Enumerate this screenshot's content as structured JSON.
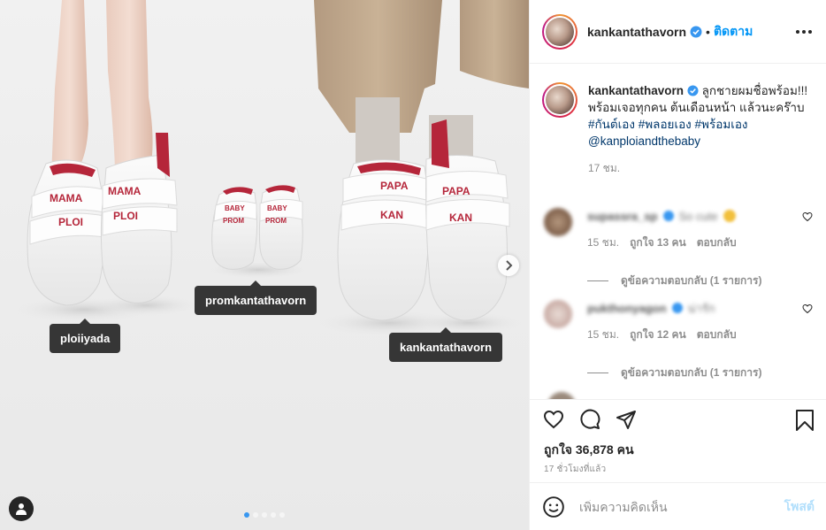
{
  "photo": {
    "tags": [
      "ploiiyada",
      "promkantathavorn",
      "kankantathavorn"
    ],
    "shoe_labels": {
      "mama_word": "MAMA",
      "ploi_word": "PLOI",
      "baby_word": "BABY",
      "prom_word": "PROM",
      "papa_word": "PAPA",
      "kan_word": "KAN"
    },
    "carousel_dots": 5,
    "active_dot": 0
  },
  "header": {
    "username": "kankantathavorn",
    "separator": "•",
    "follow_label": "ติดตาม"
  },
  "caption": {
    "username": "kankantathavorn",
    "text_plain": "ลูกชายผมชื่อพร้อม!!! พร้อมเจอทุกคน ต้นเดือนหน้า แล้วนะคร๊าบ",
    "hashtag1": "#กันต์เอง",
    "hashtag2": "#พลอยเอง",
    "hashtag3": "#พร้อมเอง",
    "mention": "@kanploiandthebaby",
    "time": "17 ชม."
  },
  "comments": [
    {
      "username": "supassra_sp",
      "text": "So cute",
      "time": "15 ชม.",
      "likes": "ถูกใจ 13 คน",
      "reply_label": "ตอบกลับ",
      "view_replies": "ดูข้อความตอบกลับ (1 รายการ)"
    },
    {
      "username": "pukthonyagon",
      "text": "น่ารัก",
      "time": "15 ชม.",
      "likes": "ถูกใจ 12 คน",
      "reply_label": "ตอบกลับ",
      "view_replies": "ดูข้อความตอบกลับ (1 รายการ)"
    }
  ],
  "actions": {
    "likes_text": "ถูกใจ 36,878 คน",
    "time_ago": "17 ชั่วโมงที่แล้ว"
  },
  "add_comment": {
    "placeholder": "เพิ่มความคิดเห็น",
    "post_label": "โพสต์"
  },
  "colors": {
    "link_blue": "#0095f6",
    "verified_blue": "#3897f0",
    "muted": "#8e8e8e",
    "shoe_red": "#b5263a"
  }
}
